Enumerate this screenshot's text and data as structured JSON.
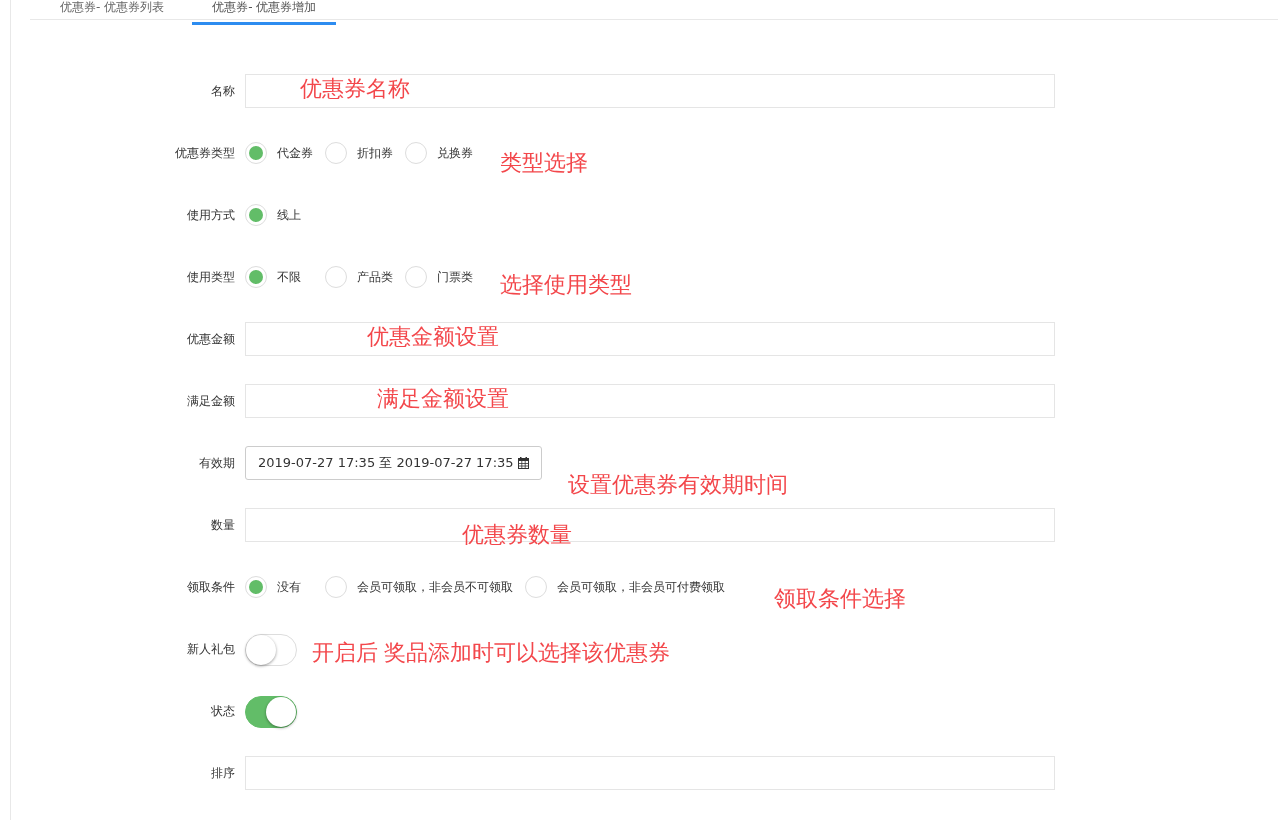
{
  "tabs": [
    {
      "label": "优惠券- 优惠券列表",
      "selected": false
    },
    {
      "label": "优惠券- 优惠券增加",
      "selected": true
    }
  ],
  "form": {
    "rows": [
      {
        "kind": "text",
        "label": "名称",
        "annotation": "优惠券名称"
      },
      {
        "kind": "radio",
        "label": "优惠券类型",
        "options": [
          {
            "label": "代金券",
            "selected": true
          },
          {
            "label": "折扣券",
            "selected": false
          },
          {
            "label": "兑换券",
            "selected": false
          }
        ],
        "annotation": "类型选择"
      },
      {
        "kind": "radio",
        "label": "使用方式",
        "options": [
          {
            "label": "线上",
            "selected": true
          }
        ]
      },
      {
        "kind": "radio",
        "label": "使用类型",
        "options": [
          {
            "label": "不限",
            "selected": true
          },
          {
            "label": "产品类",
            "selected": false
          },
          {
            "label": "门票类",
            "selected": false
          }
        ],
        "annotation": "选择使用类型"
      },
      {
        "kind": "text",
        "label": "优惠金额",
        "annotation": "优惠金额设置"
      },
      {
        "kind": "text",
        "label": "满足金额",
        "annotation": "满足金额设置"
      },
      {
        "kind": "daterange",
        "label": "有效期",
        "value": "2019-07-27 17:35 至 2019-07-27 17:35",
        "annotation": "设置优惠券有效期时间"
      },
      {
        "kind": "text",
        "label": "数量",
        "annotation": "优惠券数量"
      },
      {
        "kind": "radio",
        "label": "领取条件",
        "options": [
          {
            "label": "没有",
            "selected": true
          },
          {
            "label": "会员可领取，非会员不可领取",
            "selected": false
          },
          {
            "label": "会员可领取，非会员可付费领取",
            "selected": false
          }
        ],
        "annotation": "领取条件选择"
      },
      {
        "kind": "switch",
        "label": "新人礼包",
        "on": false,
        "annotation": "开启后  奖品添加时可以选择该优惠券"
      },
      {
        "kind": "switch",
        "label": "状态",
        "on": true
      },
      {
        "kind": "text",
        "label": "排序"
      }
    ]
  }
}
